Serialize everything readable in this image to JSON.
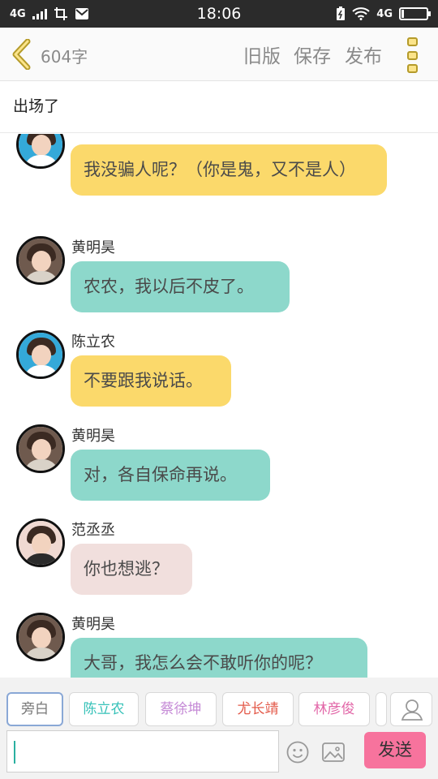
{
  "status_bar": {
    "network_left": "4G",
    "time": "18:06",
    "network_right": "4G",
    "battery_fraction": 0.1
  },
  "toolbar": {
    "word_count": "604字",
    "old_version": "旧版",
    "save": "保存",
    "publish": "发布",
    "icons": [
      "back-chevron-icon",
      "more-dots-icon"
    ]
  },
  "title": "出场了",
  "messages": [
    {
      "speaker": "",
      "text": "我没骗人呢？（你是鬼，又不是人）",
      "color": "#fbd96b",
      "avatar": "chen"
    },
    {
      "speaker": "黄明昊",
      "text": "农农，我以后不皮了。",
      "color": "#8dd8cb",
      "avatar": "huang"
    },
    {
      "speaker": "陈立农",
      "text": "不要跟我说话。",
      "color": "#fbd96b",
      "avatar": "chen"
    },
    {
      "speaker": "黄明昊",
      "text": "对，各自保命再说。",
      "color": "#8dd8cb",
      "avatar": "huang"
    },
    {
      "speaker": "范丞丞",
      "text": "你也想逃？",
      "color": "#f1dfdd",
      "avatar": "fan"
    },
    {
      "speaker": "黄明昊",
      "text": "大哥，我怎么会不敢听你的呢？",
      "color": "#8dd8cb",
      "avatar": "huang"
    }
  ],
  "roles": [
    {
      "label": "旁白",
      "color": "#777777",
      "selected": true
    },
    {
      "label": "陈立农",
      "color": "#35c1b8",
      "selected": false
    },
    {
      "label": "蔡徐坤",
      "color": "#c58ad6",
      "selected": false
    },
    {
      "label": "尤长靖",
      "color": "#e35a4a",
      "selected": false
    },
    {
      "label": "林彦俊",
      "color": "#e267a8",
      "selected": false
    }
  ],
  "input": {
    "value": ""
  },
  "send_label": "发送",
  "colors": {
    "accent_yellow": "#fbd96b",
    "accent_teal": "#8dd8cb",
    "send_pink": "#f7739d"
  }
}
